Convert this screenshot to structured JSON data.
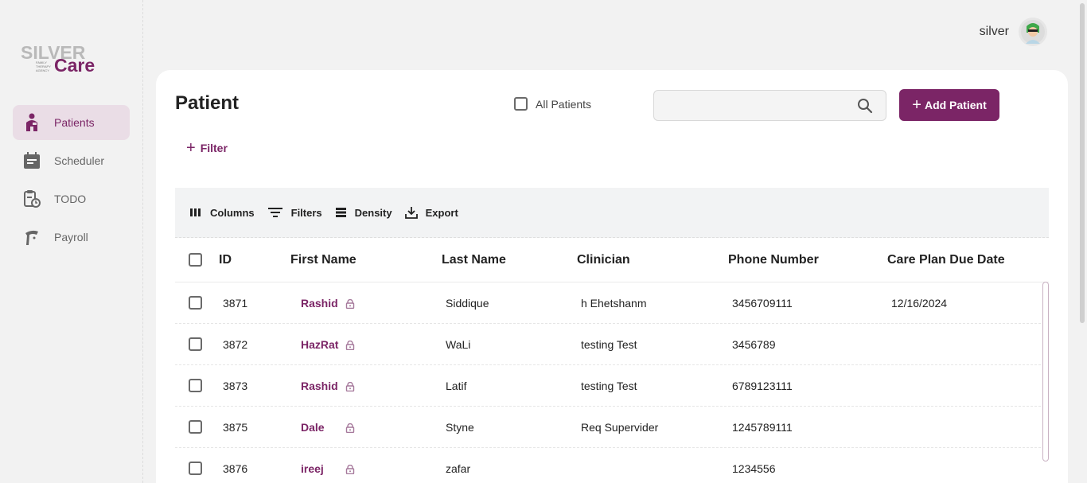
{
  "app": {
    "logo_top": "SILVER",
    "logo_small": "FAMILY THERAPY AGENCY",
    "logo_bottom": "Care",
    "brand_color": "#7b2566"
  },
  "user": {
    "name": "silver",
    "avatar_icon": "user-avatar-icon"
  },
  "sidebar": {
    "items": [
      {
        "label": "Patients",
        "icon": "patient-icon",
        "active": true
      },
      {
        "label": "Scheduler",
        "icon": "calendar-icon",
        "active": false
      },
      {
        "label": "TODO",
        "icon": "clipboard-clock-icon",
        "active": false
      },
      {
        "label": "Payroll",
        "icon": "payroll-hand-icon",
        "active": false
      }
    ]
  },
  "page": {
    "title": "Patient",
    "all_patients_label": "All Patients",
    "search_placeholder": "",
    "add_button_label": "Add Patient",
    "filter_label": "Filter"
  },
  "toolbar": {
    "columns": "Columns",
    "filters": "Filters",
    "density": "Density",
    "export": "Export"
  },
  "table": {
    "headers": {
      "id": "ID",
      "first_name": "First Name",
      "last_name": "Last Name",
      "clinician": "Clinician",
      "phone": "Phone Number",
      "care_plan": "Care Plan Due Date"
    },
    "rows": [
      {
        "id": "3871",
        "first_name": "Rashid",
        "last_name": "Siddique",
        "clinician": "h Ehetshanm",
        "phone": "3456709111",
        "care_plan": "12/16/2024"
      },
      {
        "id": "3872",
        "first_name": "HazRat",
        "last_name": "WaLi",
        "clinician": "testing Test",
        "phone": "3456789",
        "care_plan": ""
      },
      {
        "id": "3873",
        "first_name": "Rashid",
        "last_name": "Latif",
        "clinician": "testing Test",
        "phone": "6789123111",
        "care_plan": ""
      },
      {
        "id": "3875",
        "first_name": "Dale",
        "last_name": "Styne",
        "clinician": "Req Supervider",
        "phone": "1245789111",
        "care_plan": ""
      },
      {
        "id": "3876",
        "first_name": "ireej",
        "last_name": "zafar",
        "clinician": "",
        "phone": "1234556",
        "care_plan": ""
      }
    ]
  }
}
